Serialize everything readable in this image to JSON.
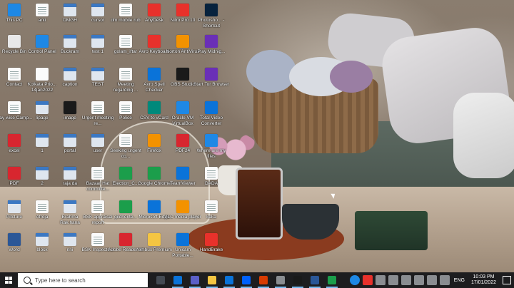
{
  "desktop": {
    "icons": [
      {
        "label": "This PC",
        "icon": "this-pc-icon",
        "color": "#1e88e5"
      },
      {
        "label": "anti",
        "icon": "document-icon",
        "color": "#fbfbfb"
      },
      {
        "label": "DMGH",
        "icon": "window-icon",
        "color": "#dfe6ef"
      },
      {
        "label": "cursor",
        "icon": "window-icon",
        "color": "#dfe6ef"
      },
      {
        "label": "dm mobile rub",
        "icon": "document-icon",
        "color": "#fbfbfb"
      },
      {
        "label": "AnyDesk",
        "icon": "anydesk-icon",
        "color": "#e8312b"
      },
      {
        "label": "Nitro Pro 10",
        "icon": "nitro-icon",
        "color": "#e8312b"
      },
      {
        "label": "Photosho... - Shortcut",
        "icon": "photoshop-icon",
        "color": "#07223d"
      },
      {
        "label": "Recycle Bin",
        "icon": "recycle-bin-icon",
        "color": "#e8e8e8"
      },
      {
        "label": "Control Panel",
        "icon": "control-panel-icon",
        "color": "#1e88e5"
      },
      {
        "label": "Buckram",
        "icon": "window-icon",
        "color": "#dfe6ef"
      },
      {
        "label": "test 1",
        "icon": "window-icon",
        "color": "#dfe6ef"
      },
      {
        "label": "golam_iftar",
        "icon": "document-icon",
        "color": "#fbfbfb"
      },
      {
        "label": "Avro Keyboard",
        "icon": "avro-icon",
        "color": "#e8312b"
      },
      {
        "label": "Norton AntiVirus",
        "icon": "norton-icon",
        "color": "#f39200"
      },
      {
        "label": "Play Midnig...",
        "icon": "game-icon",
        "color": "#6a2fb7"
      },
      {
        "label": "Contact",
        "icon": "document-icon",
        "color": "#fbfbfb"
      },
      {
        "label": "Kolkata Prio... 14jan2022",
        "icon": "spreadsheet-icon",
        "color": "#fbfbfb"
      },
      {
        "label": "caption",
        "icon": "window-icon",
        "color": "#dfe6ef"
      },
      {
        "label": "TEST",
        "icon": "window-icon",
        "color": "#dfe6ef"
      },
      {
        "label": "Meeting regarding ...",
        "icon": "document-icon",
        "color": "#fbfbfb"
      },
      {
        "label": "Avro Spell Checker",
        "icon": "spell-checker-icon",
        "color": "#0a73d9"
      },
      {
        "label": "OBS Studio",
        "icon": "obs-icon",
        "color": "#1a1a1a"
      },
      {
        "label": "Start Tor Browser",
        "icon": "tor-icon",
        "color": "#6a2fb7"
      },
      {
        "label": "Day wise Camp...",
        "icon": "document-icon",
        "color": "#fbfbfb"
      },
      {
        "label": "lipage",
        "icon": "window-icon",
        "color": "#dfe6ef"
      },
      {
        "label": "image",
        "icon": "image-icon",
        "color": "#1a1a1a"
      },
      {
        "label": "Urgent meeting re...",
        "icon": "document-icon",
        "color": "#fbfbfb"
      },
      {
        "label": "Police",
        "icon": "document-icon",
        "color": "#fbfbfb"
      },
      {
        "label": "CSV to vCard",
        "icon": "csv-vcard-icon",
        "color": "#00897b"
      },
      {
        "label": "Oracle VM VirtualBox",
        "icon": "virtualbox-icon",
        "color": "#1e88e5"
      },
      {
        "label": "Total Video Converter",
        "icon": "video-converter-icon",
        "color": "#0a73d9"
      },
      {
        "label": "excel",
        "icon": "pdf-icon",
        "color": "#d8262f"
      },
      {
        "label": "1",
        "icon": "window-icon",
        "color": "#dfe6ef"
      },
      {
        "label": "portal",
        "icon": "window-icon",
        "color": "#dfe6ef"
      },
      {
        "label": "user",
        "icon": "window-icon",
        "color": "#dfe6ef"
      },
      {
        "label": "Seeking urgent co...",
        "icon": "document-icon",
        "color": "#fbfbfb"
      },
      {
        "label": "Firefox",
        "icon": "firefox-icon",
        "color": "#f39200"
      },
      {
        "label": "PDF24",
        "icon": "pdf24-icon",
        "color": "#d8262f"
      },
      {
        "label": "Where are my files",
        "icon": "help-icon",
        "color": "#1e88e5"
      },
      {
        "label": "PDF",
        "icon": "pdf-icon",
        "color": "#d8262f"
      },
      {
        "label": "2",
        "icon": "window-icon",
        "color": "#dfe6ef"
      },
      {
        "label": "raja da",
        "icon": "window-icon",
        "color": "#dfe6ef"
      },
      {
        "label": "Bazaar Hat committe...",
        "icon": "document-icon",
        "color": "#fbfbfb"
      },
      {
        "label": "Election_C...",
        "icon": "spreadsheet-icon",
        "color": "#1b9e4b"
      },
      {
        "label": "Google Chrome",
        "icon": "chrome-icon",
        "color": "#1b9e4b"
      },
      {
        "label": "TeamViewer",
        "icon": "teamviewer-icon",
        "color": "#0a73d9"
      },
      {
        "label": "DADA",
        "icon": "document-icon",
        "color": "#fbfbfb"
      },
      {
        "label": "Pitcture",
        "icon": "window-icon",
        "color": "#dfe6ef"
      },
      {
        "label": "Afroja",
        "icon": "document-icon",
        "color": "#fbfbfb"
      },
      {
        "label": "Brahma Rak.hana",
        "icon": "window-icon",
        "color": "#dfe6ef"
      },
      {
        "label": "BSK appraisal report",
        "icon": "document-icon",
        "color": "#fbfbfb"
      },
      {
        "label": "gildhente...",
        "icon": "spreadsheet-icon",
        "color": "#1b9e4b"
      },
      {
        "label": "Microsoft Edge",
        "icon": "edge-icon",
        "color": "#0a73d9"
      },
      {
        "label": "VLC media player",
        "icon": "vlc-icon",
        "color": "#f39200"
      },
      {
        "label": "kaka",
        "icon": "document-icon",
        "color": "#fbfbfb"
      },
      {
        "label": "Word",
        "icon": "word-icon",
        "color": "#2b5797"
      },
      {
        "label": "block",
        "icon": "window-icon",
        "color": "#dfe6ef"
      },
      {
        "label": "nni",
        "icon": "window-icon",
        "color": "#dfe6ef"
      },
      {
        "label": "BSK Inspecto...",
        "icon": "document-icon",
        "color": "#fbfbfb"
      },
      {
        "label": "Adobe Reader XI",
        "icon": "adobe-reader-icon",
        "color": "#d8262f"
      },
      {
        "label": "Nimbus Premium",
        "icon": "nimbus-icon",
        "color": "#f4c542"
      },
      {
        "label": "Unicam Portable...",
        "icon": "unicam-icon",
        "color": "#0a73d9"
      },
      {
        "label": "HandBrake",
        "icon": "handbrake-icon",
        "color": "#e8312b"
      }
    ]
  },
  "taskbar": {
    "search_placeholder": "Type here to search",
    "apps": [
      {
        "name": "task-view-icon",
        "color": "#444a52"
      },
      {
        "name": "edge-taskbar-icon",
        "color": "#0a73d9"
      },
      {
        "name": "teams-icon",
        "color": "#5b5fc7"
      },
      {
        "name": "file-explorer-icon",
        "color": "#f4c542"
      },
      {
        "name": "mail-icon",
        "color": "#0a73d9"
      },
      {
        "name": "dropbox-icon",
        "color": "#0061fe"
      },
      {
        "name": "office-icon",
        "color": "#d83b01"
      },
      {
        "name": "screen-sketch-icon",
        "color": "#8a8d91"
      },
      {
        "name": "obs-taskbar-icon",
        "color": "#1a1a1a"
      },
      {
        "name": "word-taskbar-icon",
        "color": "#2b5797"
      },
      {
        "name": "chrome-taskbar-icon",
        "color": "#1b9e4b"
      }
    ],
    "tray": {
      "language": "ENG",
      "time": "10:03 PM",
      "date": "17/01/2022"
    }
  }
}
